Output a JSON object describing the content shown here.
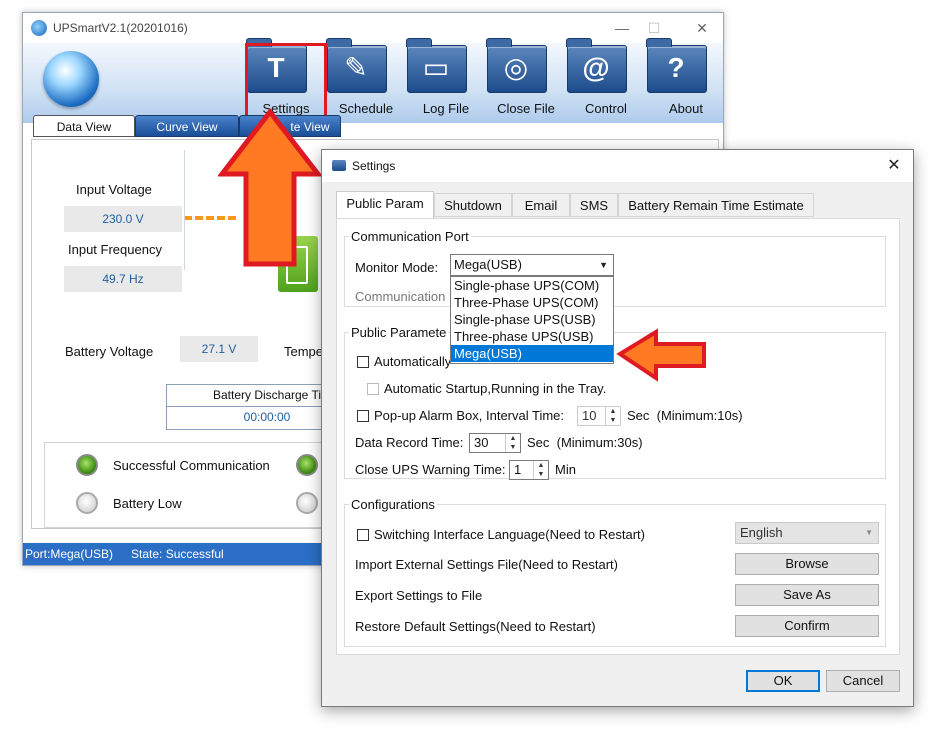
{
  "main_window": {
    "title": "UPSmartV2.1(20201016)",
    "toolbar": [
      {
        "label": "Settings",
        "icon": "hammer-icon",
        "glyph": "T"
      },
      {
        "label": "Schedule",
        "icon": "schedule-icon",
        "glyph": "✎"
      },
      {
        "label": "Log File",
        "icon": "log-file-icon",
        "glyph": "▭"
      },
      {
        "label": "Close File",
        "icon": "close-file-icon",
        "glyph": "◎"
      },
      {
        "label": "Control",
        "icon": "at-icon",
        "glyph": "@"
      },
      {
        "label": "About",
        "icon": "question-icon",
        "glyph": "?"
      }
    ],
    "view_tabs": [
      "Data View",
      "Curve View",
      "te View"
    ],
    "data": {
      "input_voltage_label": "Input Voltage",
      "input_voltage_value": "230.0 V",
      "input_frequency_label": "Input Frequency",
      "input_frequency_value": "49.7 Hz",
      "battery_voltage_label": "Battery Voltage",
      "battery_voltage_value": "27.1 V",
      "temperature_label_partial": "Tempe",
      "battery_discharge_label": "Battery Discharge Ti",
      "battery_discharge_value": "00:00:00"
    },
    "indicators": {
      "successful_communication": "Successful Communication",
      "battery_low": "Battery Low"
    },
    "status_bar": {
      "port": "Port:Mega(USB)",
      "state": "State: Successful"
    }
  },
  "settings_dialog": {
    "title": "Settings",
    "tabs": [
      "Public Param",
      "Shutdown",
      "Email",
      "SMS",
      "Battery Remain Time Estimate"
    ],
    "communication_port": {
      "legend": "Communication Port",
      "monitor_mode_label": "Monitor Mode:",
      "monitor_mode_value": "Mega(USB)",
      "communication_label_partial": "Communication",
      "options": [
        "Single-phase UPS(COM)",
        "Three-Phase UPS(COM)",
        "Single-phase UPS(USB)",
        "Three-phase UPS(USB)",
        "Mega(USB)"
      ],
      "selected_option": "Mega(USB)"
    },
    "public_params": {
      "legend": "Public Paramete",
      "auto_start_label": "Automatically",
      "auto_startup_tray_label": "Automatic Startup,Running in the Tray.",
      "popup_alarm_label": "Pop-up Alarm Box, Interval Time:",
      "popup_interval_value": "10",
      "popup_suffix": "Sec  (Minimum:10s)",
      "data_record_label": "Data Record Time:",
      "data_record_value": "30",
      "data_record_suffix": "Sec  (Minimum:30s)",
      "close_warning_label": "Close UPS Warning Time:",
      "close_warning_value": "1",
      "close_warning_suffix": "Min"
    },
    "configurations": {
      "legend": "Configurations",
      "switch_language_label": "Switching Interface Language(Need to Restart)",
      "language_value": "English",
      "import_label": "Import External Settings File(Need to Restart)",
      "import_button": "Browse",
      "export_label": "Export Settings to File",
      "export_button": "Save As",
      "restore_label": "Restore Default Settings(Need to Restart)",
      "restore_button": "Confirm"
    },
    "ok_button": "OK",
    "cancel_button": "Cancel"
  },
  "colors": {
    "highlight_red": "#e01a22",
    "arrow_orange": "#ff7a22",
    "selection_blue": "#0078d7",
    "status_bar_blue": "#2a6fc5"
  }
}
